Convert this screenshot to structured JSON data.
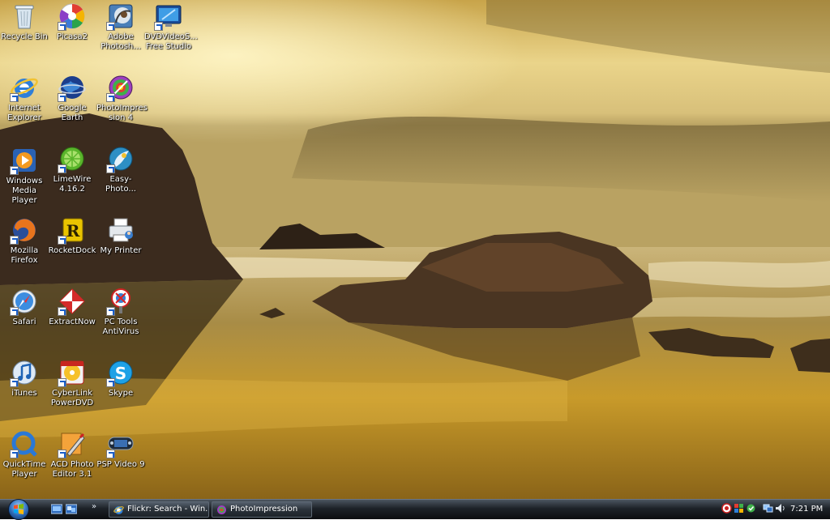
{
  "desktop": {
    "icons": [
      {
        "label": "Recycle Bin"
      },
      {
        "label": "Picasa2"
      },
      {
        "label": "Adobe\nPhotosh..."
      },
      {
        "label": "DVDVideoS...\nFree Studio"
      },
      {
        "label": "Internet\nExplorer"
      },
      {
        "label": "Google Earth"
      },
      {
        "label": "PhotoImpres\nsion 4"
      },
      {
        "label": "Windows\nMedia Player"
      },
      {
        "label": "LimeWire\n4.16.2"
      },
      {
        "label": "Easy-Photo..."
      },
      {
        "label": "Mozilla\nFirefox"
      },
      {
        "label": "RocketDock"
      },
      {
        "label": "My Printer"
      },
      {
        "label": "Safari"
      },
      {
        "label": "ExtractNow"
      },
      {
        "label": "PC Tools\nAntiVirus"
      },
      {
        "label": "iTunes"
      },
      {
        "label": "CyberLink\nPowerDVD"
      },
      {
        "label": "Skype"
      },
      {
        "label": "QuickTime\nPlayer"
      },
      {
        "label": "ACD Photo\nEditor 3.1"
      },
      {
        "label": "PSP Video 9"
      }
    ]
  },
  "taskbar": {
    "quick_launch_more": "»",
    "windows": [
      {
        "title": "Flickr: Search - Win...",
        "icon": "internet-explorer-icon"
      },
      {
        "title": "PhotoImpression",
        "icon": "photoimpression-icon"
      }
    ],
    "clock": "7:21 PM"
  },
  "colors": {
    "sky": "#e7cf7d",
    "sea": "#b89a4a",
    "rock": "#3b2b1e",
    "taskbar": "#1d2228"
  }
}
